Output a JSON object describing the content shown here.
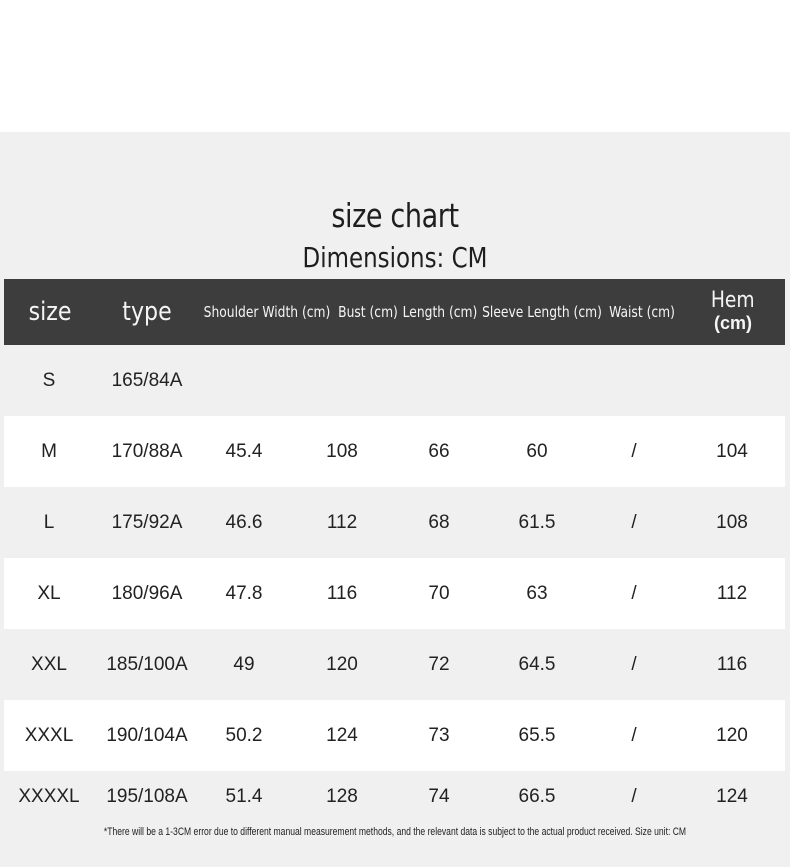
{
  "title": "size chart",
  "subtitle": "Dimensions: CM",
  "headers": {
    "size": "size",
    "type": "type",
    "shoulder": "Shoulder Width (cm)",
    "bust": "Bust (cm)",
    "length": "Length (cm)",
    "sleeve": "Sleeve Length (cm)",
    "waist": "Waist (cm)",
    "hem_line1": "Hem",
    "hem_line2": "(cm)"
  },
  "rows": [
    {
      "size": "S",
      "type": "165/84A",
      "shoulder": "",
      "bust": "",
      "length": "",
      "sleeve": "",
      "waist": "",
      "hem": ""
    },
    {
      "size": "M",
      "type": "170/88A",
      "shoulder": "45.4",
      "bust": "108",
      "length": "66",
      "sleeve": "60",
      "waist": "/",
      "hem": "104"
    },
    {
      "size": "L",
      "type": "175/92A",
      "shoulder": "46.6",
      "bust": "112",
      "length": "68",
      "sleeve": "61.5",
      "waist": "/",
      "hem": "108"
    },
    {
      "size": "XL",
      "type": "180/96A",
      "shoulder": "47.8",
      "bust": "116",
      "length": "70",
      "sleeve": "63",
      "waist": "/",
      "hem": "112"
    },
    {
      "size": "XXL",
      "type": "185/100A",
      "shoulder": "49",
      "bust": "120",
      "length": "72",
      "sleeve": "64.5",
      "waist": "/",
      "hem": "116"
    },
    {
      "size": "XXXL",
      "type": "190/104A",
      "shoulder": "50.2",
      "bust": "124",
      "length": "73",
      "sleeve": "65.5",
      "waist": "/",
      "hem": "120"
    },
    {
      "size": "XXXXL",
      "type": "195/108A",
      "shoulder": "51.4",
      "bust": "128",
      "length": "74",
      "sleeve": "66.5",
      "waist": "/",
      "hem": "124"
    }
  ],
  "footnote": "*There will be a 1-3CM error due to different manual measurement methods, and the relevant data is subject to the actual product received. Size unit: CM",
  "colors": {
    "header_bg": "#3d3d3d",
    "panel_bg": "#f0f0f0",
    "row_alt_bg": "#ffffff"
  }
}
